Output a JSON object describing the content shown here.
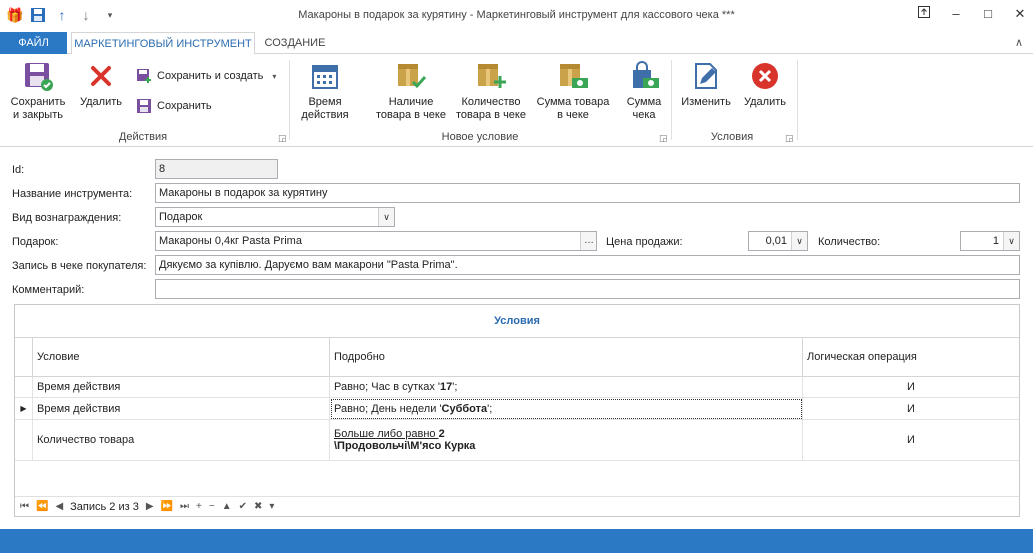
{
  "window": {
    "title": "Макароны в подарок за курятину - Маркетинговый инструмент для кассового чека ***"
  },
  "tabs": {
    "file": "ФАЙЛ",
    "marketing": "МАРКЕТИНГОВЫЙ ИНСТРУМЕНТ",
    "create": "СОЗДАНИЕ"
  },
  "ribbon": {
    "save_close_1": "Сохранить",
    "save_close_2": "и закрыть",
    "delete": "Удалить",
    "save_create": "Сохранить и создать",
    "save": "Сохранить",
    "group_actions": "Действия",
    "time_1": "Время",
    "time_2": "действия",
    "presence_1": "Наличие",
    "presence_2": "товара в чеке",
    "qty_1": "Количество",
    "qty_2": "товара в чеке",
    "sum_goods_1": "Сумма товара",
    "sum_goods_2": "в чеке",
    "sum_check_1": "Сумма",
    "sum_check_2": "чека",
    "group_new_condition": "Новое условие",
    "edit": "Изменить",
    "delete2": "Удалить",
    "group_conditions": "Условия"
  },
  "form": {
    "id_label": "Id:",
    "id_value": "8",
    "name_label": "Название инструмента:",
    "name_value": "Макароны в подарок за курятину",
    "reward_label": "Вид вознаграждения:",
    "reward_value": "Подарок",
    "gift_label": "Подарок:",
    "gift_value": "Макароны 0,4кг Pasta Prima",
    "price_label": "Цена продажи:",
    "price_value": "0,01",
    "count_label": "Количество:",
    "count_value": "1",
    "receipt_label": "Запись в чеке покупателя:",
    "receipt_value": "Дякуємо за купівлю. Даруємо вам макарони \"Pasta Prima\".",
    "comment_label": "Комментарий:",
    "comment_value": ""
  },
  "grid": {
    "title": "Условия",
    "headers": [
      "Условие",
      "Подробно",
      "Логическая операция"
    ],
    "rows": [
      {
        "condition": "Время действия",
        "detail_pre": "Равно; Час в сутках '",
        "detail_bold": "17",
        "detail_post": "';",
        "op": "И"
      },
      {
        "condition": "Время действия",
        "detail_pre": "Равно; День недели '",
        "detail_bold": "Суббота",
        "detail_post": "';",
        "op": "И"
      },
      {
        "condition": "Количество товара",
        "detail_pre": "Больше либо равно ",
        "detail_bold": "2",
        "detail_line2": "\\Продовольчі\\М'ясо Курка",
        "op": "И"
      }
    ],
    "nav_record": "Запись 2 из 3"
  },
  "colors": {
    "accent": "#2b78c5",
    "title_blue": "#2b6cb0"
  }
}
